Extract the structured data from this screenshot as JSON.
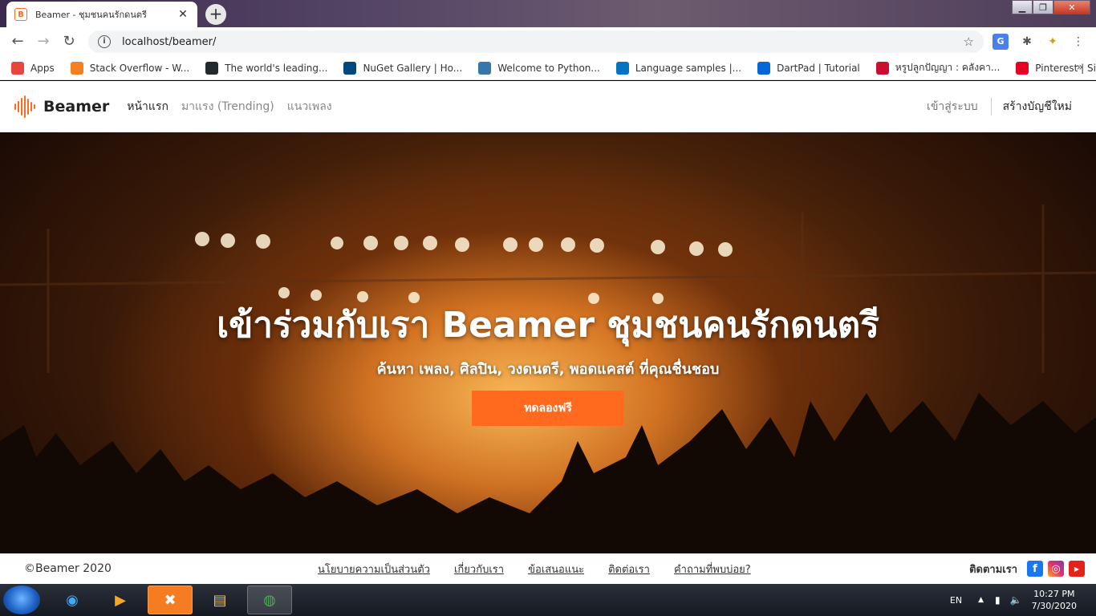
{
  "browser": {
    "tab_title": "Beamer - ชุมชนคนรักดนตรี",
    "tab_favicon": "B",
    "url": "localhost/beamer/",
    "bookmarks": [
      {
        "label": "Apps",
        "color": "#e8453c"
      },
      {
        "label": "Stack Overflow - W...",
        "color": "#f48024"
      },
      {
        "label": "The world's leading...",
        "color": "#24292e"
      },
      {
        "label": "NuGet Gallery | Ho...",
        "color": "#004880"
      },
      {
        "label": "Welcome to Python...",
        "color": "#3776ab"
      },
      {
        "label": "Language samples |...",
        "color": "#0175c2"
      },
      {
        "label": "DartPad | Tutorial",
        "color": "#0468d7"
      },
      {
        "label": "หรูปลูกปัญญา : คลังคา...",
        "color": "#c8102e"
      },
      {
        "label": "Pinterest | Sign up t...",
        "color": "#e60023"
      }
    ]
  },
  "site": {
    "brand": "Beamer",
    "brand_color": "#ff6a1f",
    "nav": {
      "home": "หน้าแรก",
      "trending": "มาแรง (Trending)",
      "genres": "แนวเพลง"
    },
    "login": "เข้าสู่ระบบ",
    "signup": "สร้างบัญชีใหม่"
  },
  "hero": {
    "title": "เข้าร่วมกับเรา Beamer ชุมชนคนรักดนตรี",
    "subtitle": "ค้นหา เพลง, ศิลปิน, วงดนตรี, พอดแคสต์ ที่คุณชื่นชอบ",
    "cta": "ทดลองฟรี"
  },
  "footer": {
    "copyright": "©Beamer 2020",
    "links": [
      "นโยบายความเป็นส่วนตัว",
      "เกี่ยวกับเรา",
      "ข้อเสนอแนะ",
      "ติดต่อเรา",
      "คำถามที่พบบ่อย?"
    ],
    "follow": "ติดตามเรา"
  },
  "taskbar": {
    "lang": "EN",
    "time": "10:27 PM",
    "date": "7/30/2020"
  }
}
